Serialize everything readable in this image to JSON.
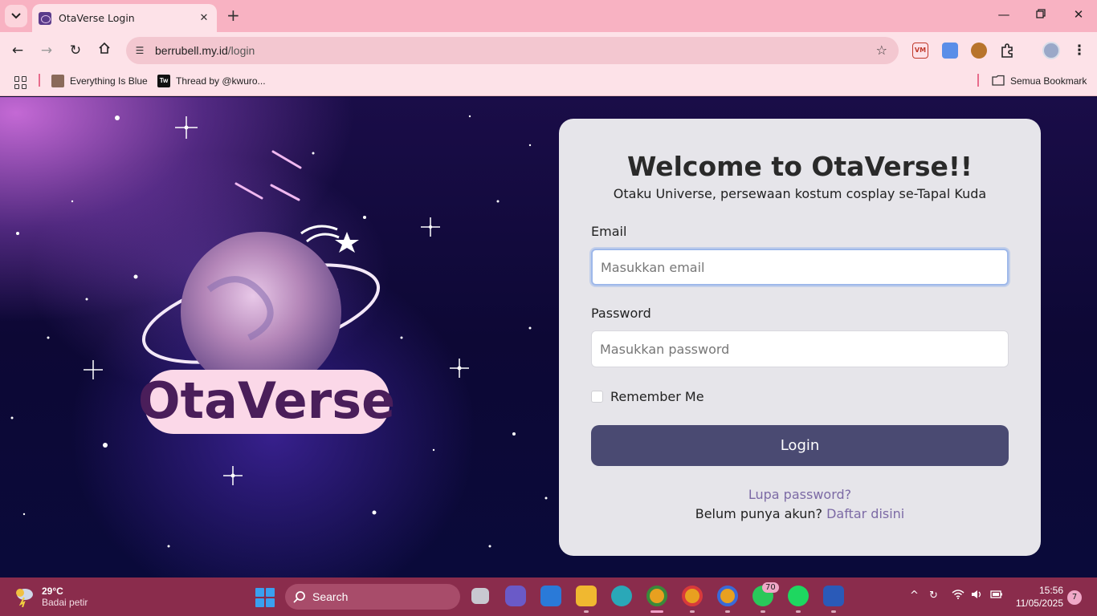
{
  "browser": {
    "tab_title": "OtaVerse Login",
    "url_host": "berrubell.my.id",
    "url_path": "/login",
    "bookmarks": [
      {
        "label": "Everything Is Blue"
      },
      {
        "label": "Thread by @kwuro..."
      }
    ],
    "all_bookmarks": "Semua Bookmark"
  },
  "page": {
    "welcome": "Welcome to OtaVerse!!",
    "subtitle": "Otaku Universe, persewaan kostum cosplay se-Tapal Kuda",
    "email_label": "Email",
    "email_placeholder": "Masukkan email",
    "password_label": "Password",
    "password_placeholder": "Masukkan password",
    "remember_label": "Remember Me",
    "login_label": "Login",
    "forgot_label": "Lupa password?",
    "register_prefix": "Belum punya akun?",
    "register_link": "Daftar disini",
    "logo_text": "OtaVerse"
  },
  "taskbar": {
    "temperature": "29°C",
    "weather": "Badai petir",
    "search_label": "Search",
    "whatsapp_badge": "70",
    "time": "15:56",
    "date": "11/05/2025",
    "notifications": "7"
  },
  "colors": {
    "tab_strip": "#f8b2c2",
    "toolbar": "#fde2e8",
    "login_button": "#4a4a72",
    "link": "#7c6aa5",
    "taskbar": "#8a2c4c"
  }
}
